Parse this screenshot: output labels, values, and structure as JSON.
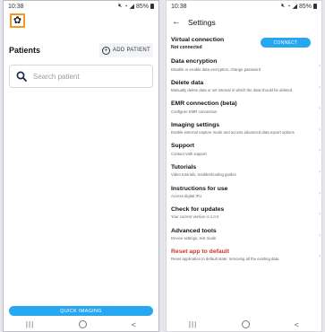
{
  "left": {
    "status": {
      "time": "10:38",
      "battery": "85%"
    },
    "patients_title": "Patients",
    "add_patient_label": "ADD PATIENT",
    "search": {
      "placeholder": "Search patient"
    },
    "quick_imaging_label": "QUICK IMAGING",
    "nav": {
      "recent": "|||",
      "home": "",
      "back": "<"
    }
  },
  "right": {
    "status": {
      "time": "10:38",
      "battery": "85%"
    },
    "header_title": "Settings",
    "connect_label": "CONNECT",
    "items": [
      {
        "title": "Virtual connection",
        "desc": "Not connected"
      },
      {
        "title": "Data encryption",
        "desc": "Disable or enable data encryption, change password"
      },
      {
        "title": "Delete data",
        "desc": "Manually delete data or set interval in which the data should be deleted"
      },
      {
        "title": "EMR connection (beta)",
        "desc": "Configure EMR connection"
      },
      {
        "title": "Imaging settings",
        "desc": "Enable external capture mode and access advanced data export options"
      },
      {
        "title": "Support",
        "desc": "Contact Volk support"
      },
      {
        "title": "Tutorials",
        "desc": "Video tutorials, troubleshooting guides"
      },
      {
        "title": "Instructions for use",
        "desc": "Access digital IFU"
      },
      {
        "title": "Check for updates",
        "desc": "Your current version is 1.0.0"
      },
      {
        "title": "Advanced tools",
        "desc": "Device settings, test mode"
      },
      {
        "title": "Reset app to default",
        "desc": "Reset application to default state, removing all the existing data"
      }
    ],
    "nav": {
      "recent": "|||",
      "home": "",
      "back": "<"
    }
  },
  "colors": {
    "accent": "#27a7f2",
    "highlight": "#f39a1e",
    "danger": "#d0342c"
  }
}
